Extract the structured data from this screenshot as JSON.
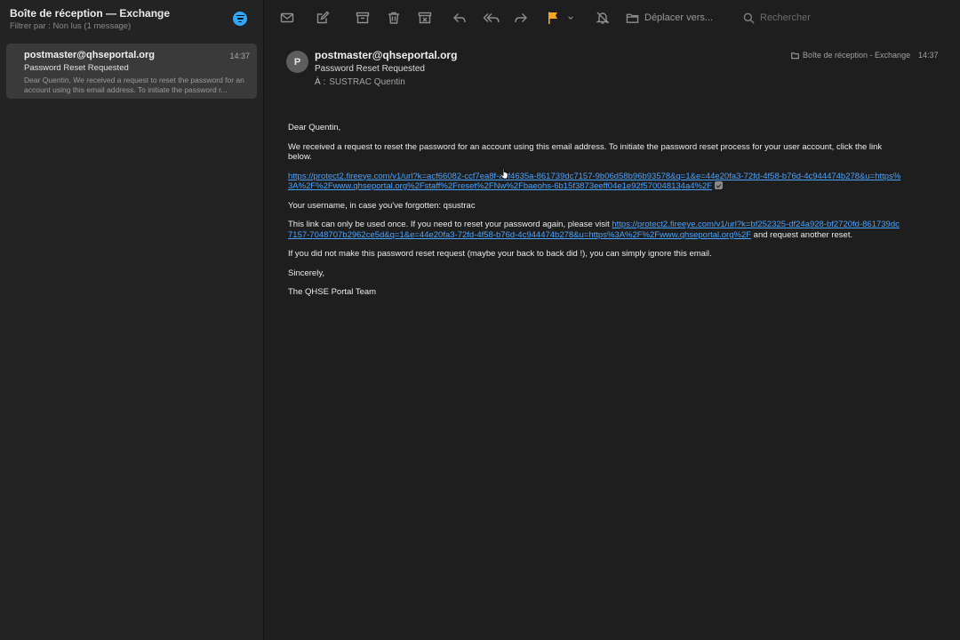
{
  "sidebar": {
    "title": "Boîte de réception — Exchange",
    "filter_text": "Filtrer par : Non lus (1 message)",
    "message": {
      "from": "postmaster@qhseportal.org",
      "time": "14:37",
      "subject": "Password Reset Requested",
      "preview": "Dear Quentin, We received a request to reset the password for an account using this email address. To initiate the password r..."
    }
  },
  "toolbar": {
    "icons": [
      "envelope-icon",
      "compose-icon",
      "archive-icon",
      "trash-icon",
      "junk-icon",
      "reply-icon",
      "reply-all-icon",
      "forward-icon",
      "flag-icon",
      "chevron-down-icon",
      "mute-icon"
    ],
    "flag_color": "#f5a623",
    "move_label": "Déplacer vers...",
    "search_placeholder": "Rechercher"
  },
  "header": {
    "avatar_initial": "P",
    "from": "postmaster@qhseportal.org",
    "subject": "Password Reset Requested",
    "to_label": "À :",
    "to_name": "SUSTRAC Quentin",
    "folder": "Boîte de réception - Exchange",
    "time": "14:37"
  },
  "body": {
    "greeting": "Dear Quentin,",
    "p1": "We received a request to reset the password for an account using this email address. To initiate the password reset process for your user account, click the link below.",
    "link1": "https://protect2.fireeye.com/v1/url?k=acf66082-ccf7ea8f-acf4635a-861739dc7157-9b06d58b96b93578&q=1&e=44e20fa3-72fd-4f58-b76d-4c944474b278&u=https%3A%2F%2Fwww.qhseportal.org%2Fstaff%2Freset%2FNw%2Fbaeohs-6b15f3873eeff04e1e92f570048134a4%2F",
    "p2": "Your username, in case you've forgotten: qsustrac",
    "p3_before": "This link can only be used once. If you need to reset your password again, please visit ",
    "link2": "https://protect2.fireeye.com/v1/url?k=bf252325-df24a928-bf2720fd-861739dc7157-7048707b2962ce5d&q=1&e=44e20fa3-72fd-4f58-b76d-4c944474b278&u=https%3A%2F%2Fwww.qhseportal.org%2F",
    "p3_after": " and request another reset.",
    "p4": "If you did not make this password reset request (maybe your back to back did !), you can simply ignore this email.",
    "closing": "Sincerely,",
    "signature": "The QHSE Portal Team"
  }
}
